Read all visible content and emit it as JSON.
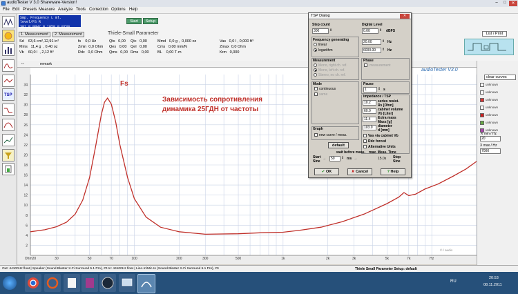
{
  "window": {
    "title": "audioTester  V 3.0 Shareware-Version!"
  },
  "menu": [
    "File",
    "Edit",
    "Presets",
    "Measure",
    "Analyze",
    "Tools",
    "Correction",
    "Options",
    "Help"
  ],
  "readout": {
    "row1": "Smp.  Frequency  L ml. level/FS  R",
    "row2": "301     0.00Hz      0.1050   0.0730"
  },
  "info_buttons": {
    "start": "Start",
    "setup": "Setup",
    "measurement1": "1. Measurement",
    "measurement2": "2. Measurement",
    "list_print": "List / Print"
  },
  "panel_title": "Thiele-Small Parameter",
  "params": {
    "col1": [
      "Sd    63,6 cm²,12,91 in²",
      "Mms   11,4 g  , 0,40 oz",
      "Vb    60,0 l  , 2,12 ft³"
    ],
    "col2": [
      "fs    0,0 Hz",
      "Zmin  0,0 Ohm",
      "Rdc   0,0 Ohm"
    ],
    "col3": [
      "Qts   0,00",
      "Qes   0,00",
      "Qms   0,00"
    ],
    "col4": [
      "Qtc   0,00",
      "Qel   0,00",
      "Rms   0,00"
    ],
    "col5": [
      "Mmd   0,0 g ,  0,000 oz",
      "Cms   0,00 mm/N",
      "BL    0,00 T·m"
    ],
    "col6": [
      "Vas   0,0 l , 0,000 ft³",
      "Zmax  0,0 Ohm",
      "Krm   0,000"
    ]
  },
  "graph": {
    "remark": "remark",
    "brand": "audioTester V3.0",
    "watermark": "© / audio"
  },
  "annotation": {
    "fs_label": "Fs",
    "caption_line1": "Зависимость сопротивления",
    "caption_line2": "динамика 25ГДН от частоты"
  },
  "chart_data": {
    "type": "line",
    "title": "",
    "xlabel": "Hz",
    "ylabel": "",
    "x_scale": "log",
    "xlim": [
      20,
      20000
    ],
    "ylim": [
      0,
      36
    ],
    "grid": true,
    "x_ticks": [
      "Ohm20",
      "30",
      "50",
      "70",
      "100",
      "200",
      "300",
      "500",
      "1k",
      "2k",
      "3k",
      "5k",
      "7k",
      "Hz"
    ],
    "y_ticks": [
      "34",
      "32",
      "30",
      "28",
      "26",
      "24",
      "22",
      "20",
      "18",
      "16",
      "14",
      "12",
      "10",
      "8",
      "6",
      "4",
      "2"
    ],
    "series": [
      {
        "color": "#c0302a",
        "points": [
          [
            20,
            4.7
          ],
          [
            25,
            5.1
          ],
          [
            30,
            5.7
          ],
          [
            35,
            6.6
          ],
          [
            40,
            8.2
          ],
          [
            45,
            11.0
          ],
          [
            50,
            15.5
          ],
          [
            55,
            21.8
          ],
          [
            60,
            28.0
          ],
          [
            63,
            30.5
          ],
          [
            66,
            31.3
          ],
          [
            70,
            30.1
          ],
          [
            75,
            26.5
          ],
          [
            80,
            22.0
          ],
          [
            90,
            15.5
          ],
          [
            100,
            11.3
          ],
          [
            120,
            7.6
          ],
          [
            150,
            5.6
          ],
          [
            200,
            4.7
          ],
          [
            300,
            4.2
          ],
          [
            500,
            4.3
          ],
          [
            700,
            4.5
          ],
          [
            1000,
            4.6
          ],
          [
            1300,
            5.0
          ],
          [
            1800,
            5.6
          ],
          [
            2500,
            6.7
          ],
          [
            3500,
            8.2
          ],
          [
            5000,
            10.3
          ],
          [
            6000,
            11.6
          ],
          [
            6500,
            12.5
          ],
          [
            7000,
            11.9
          ],
          [
            7800,
            12.2
          ],
          [
            9000,
            13.2
          ],
          [
            11000,
            14.2
          ],
          [
            14000,
            15.8
          ],
          [
            17000,
            17.2
          ],
          [
            20000,
            18.7
          ]
        ]
      }
    ]
  },
  "right_panel": {
    "clear": "clear curves",
    "curves": [
      "unknown",
      "unknown",
      "unknown",
      "unknown",
      "unknown",
      "unknown",
      "unknown",
      "unknown"
    ],
    "xmin_label": "X min / Hz",
    "xmin_value": "20",
    "xmax_label": "X max / Hz",
    "xmax_value": "7000"
  },
  "dialog": {
    "title": "TSP Dialog",
    "step_count_label": "Step count",
    "step_count_value": "300",
    "digital_level_label": "Digital Level",
    "digital_level_value": "0.00",
    "digital_level_unit": "dBFS",
    "freq_gen_label": "Frequency generating",
    "freq_linear": "linear",
    "freq_log": "logarithm",
    "freq_from": "20.00",
    "freq_to": "6000.00",
    "hz": "Hz",
    "measurement_label": "Measurement",
    "meas_opts": [
      "Mono, right ch. ref.",
      "Mono, left ch. ref.",
      "Stereo, no ch. ref."
    ],
    "phase_label": "Phase",
    "phase_measurement": "measurement",
    "mode_label": "Mode",
    "mode_continuous": "continuous",
    "mode_same": "same",
    "pause_label": "Pause",
    "pause_value": "1",
    "pause_unit": "s",
    "imp_label": "Impedance / TSP",
    "series_resist_label": "series resist.",
    "series_resist_value": "10.2",
    "rs_label": "Rs [Ohm]",
    "cab_vol_label": "cabinet volume",
    "cab_vol_value": "60.0",
    "vb_label": "Vb [Liter]",
    "extra_mass_label": "Extra mass",
    "extra_mass_value": "11.4",
    "mass_label": "Mass [g]",
    "diameter_label": "diameter",
    "diameter_value": "103.0",
    "d_label": "d [mm]",
    "vas_via_cab": "Vas via cabinet Vb",
    "rdc_forced": "Rdc forced",
    "alt_units": "Alternative Units",
    "graph_label": "Graph",
    "new_curve": "new curve / meas.",
    "default_btn": "default",
    "wait_label": "wait before meas.",
    "max_time_label": "max. Meas. Time",
    "start_label": "Start",
    "sine_label": "Sine",
    "wait_value": "50",
    "ms": "ms",
    "time_value": "15.0s",
    "stop_label": "Stop",
    "stop_sine": "Sine",
    "ok": "OK",
    "cancel": "Cancel",
    "help": "Help"
  },
  "status": {
    "left": "Out: 44100Hz float  | Speaker (Sound Blaster X-Fi Surround 5.1 Pro), #0  In: 44100Hz float  | Line-In/Mic-In (Sound Blaster X-Fi Surround 5.1 Pro), #0",
    "right": "Thiele Small Parameter  Setup: default"
  },
  "taskbar": {
    "lang": "RU",
    "time": "20:53",
    "date": "08.11.2011"
  }
}
